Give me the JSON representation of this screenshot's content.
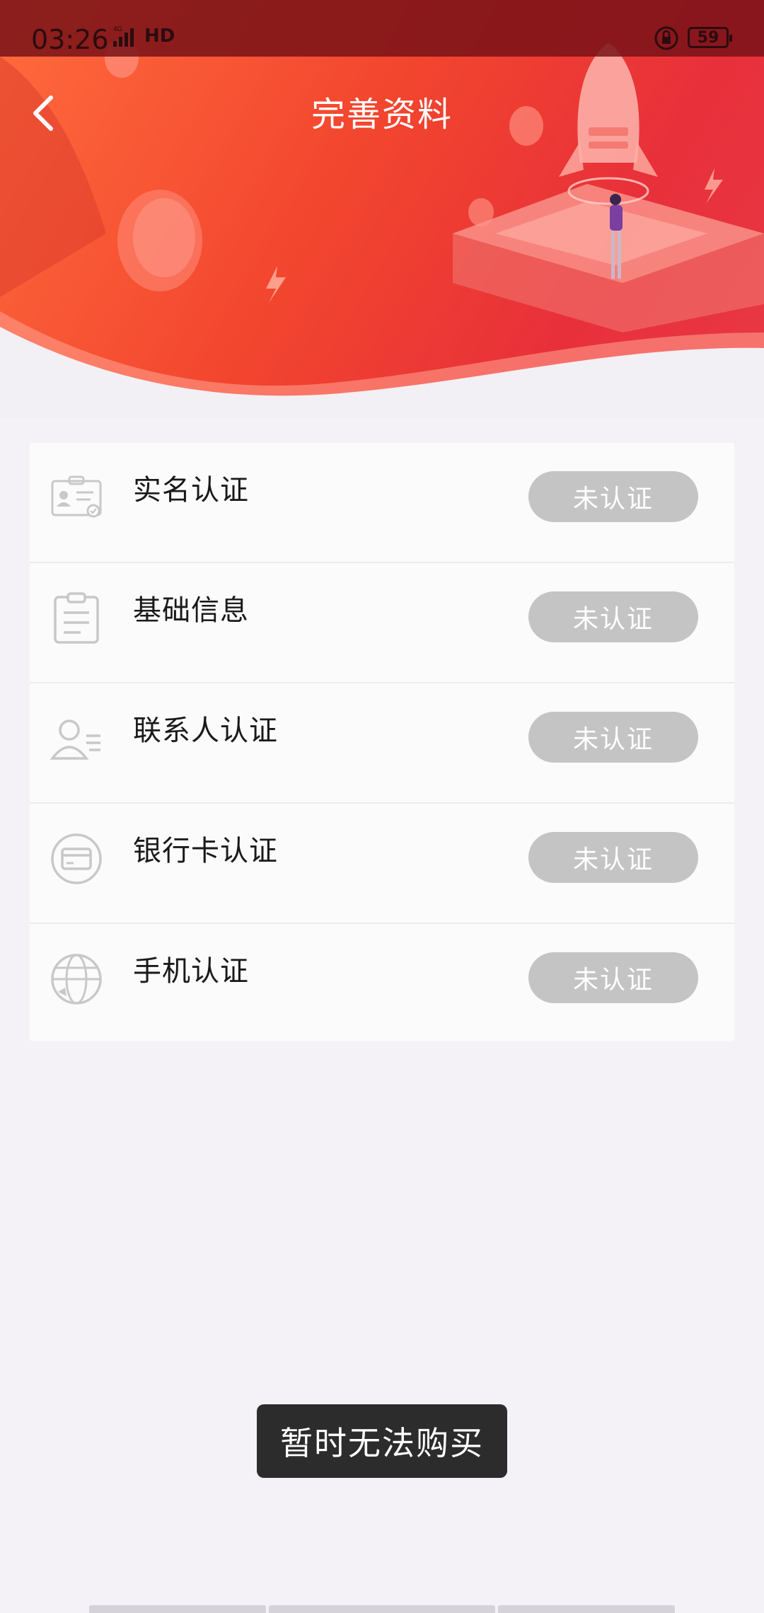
{
  "status_bar": {
    "time": "03:26",
    "network": "4G",
    "hd": "HD",
    "battery": "59"
  },
  "header": {
    "title": "完善资料",
    "back_icon": "chevron-left-icon"
  },
  "verification_items": [
    {
      "label": "实名认证",
      "status": "未认证",
      "icon": "id-card-icon"
    },
    {
      "label": "基础信息",
      "status": "未认证",
      "icon": "clipboard-icon"
    },
    {
      "label": "联系人认证",
      "status": "未认证",
      "icon": "contact-person-icon"
    },
    {
      "label": "银行卡认证",
      "status": "未认证",
      "icon": "bank-card-icon"
    },
    {
      "label": "手机认证",
      "status": "未认证",
      "icon": "globe-phone-icon"
    }
  ],
  "toast": {
    "message": "暂时无法购买"
  },
  "colors": {
    "header_gradient_start": "#ff6b3d",
    "header_gradient_end": "#e83845",
    "status_pill": "#c4c4c4",
    "toast_bg": "#2c2c2c",
    "page_bg": "#f5f2f7"
  }
}
